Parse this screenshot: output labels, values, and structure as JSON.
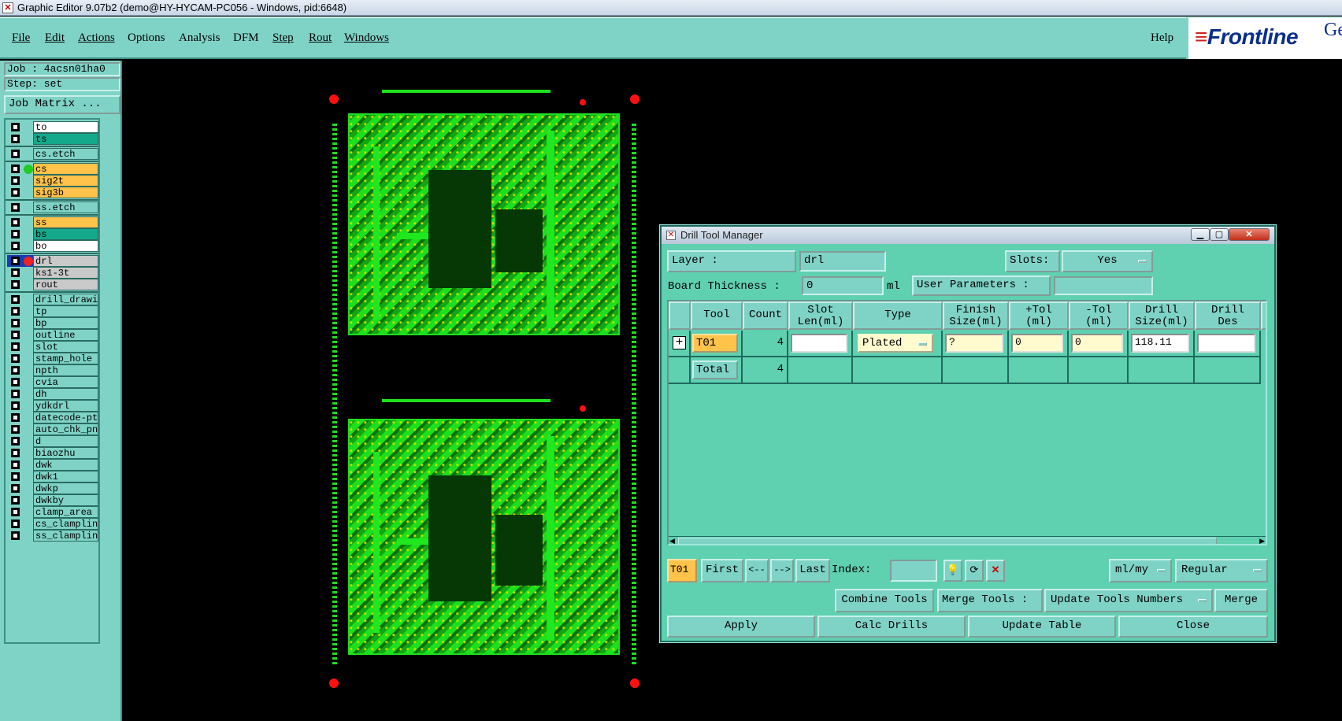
{
  "window": {
    "title": "Graphic Editor 9.07b2 (demo@HY-HYCAM-PC056 - Windows, pid:6648)"
  },
  "menu": {
    "items": [
      "File",
      "Edit",
      "Actions",
      "Options",
      "Analysis",
      "DFM",
      "Step",
      "Rout",
      "Windows"
    ],
    "help": "Help"
  },
  "logo": {
    "text": "Frontline",
    "suffix": "Ge"
  },
  "job_info": {
    "job": "Job : 4acsn01ha0",
    "step": "Step: set",
    "job_matrix": "Job Matrix ..."
  },
  "layers": [
    {
      "name": "to",
      "bg": "#ffffff"
    },
    {
      "name": "ts",
      "bg": "#14a98a"
    },
    {
      "name": "cs.etch",
      "bg": "#7fd3c6"
    },
    {
      "name": "cs",
      "bg": "#ffc24a",
      "indicator": "green"
    },
    {
      "name": "sig2t",
      "bg": "#ffc24a"
    },
    {
      "name": "sig3b",
      "bg": "#ffc24a"
    },
    {
      "name": "ss.etch",
      "bg": "#7fd3c6"
    },
    {
      "name": "ss",
      "bg": "#ffc24a"
    },
    {
      "name": "bs",
      "bg": "#14a98a"
    },
    {
      "name": "bo",
      "bg": "#ffffff"
    },
    {
      "name": "drl",
      "bg": "#c9c9c9",
      "indicator": "red",
      "selected": true
    },
    {
      "name": "ks1-3t",
      "bg": "#c9c9c9"
    },
    {
      "name": "rout",
      "bg": "#c9c9c9"
    },
    {
      "name": "drill_drawing",
      "bg": "#7fd3c6"
    },
    {
      "name": "tp",
      "bg": "#7fd3c6"
    },
    {
      "name": "bp",
      "bg": "#7fd3c6"
    },
    {
      "name": "outline",
      "bg": "#7fd3c6"
    },
    {
      "name": "slot",
      "bg": "#7fd3c6"
    },
    {
      "name": "stamp_hole",
      "bg": "#7fd3c6"
    },
    {
      "name": "npth",
      "bg": "#7fd3c6"
    },
    {
      "name": "cvia",
      "bg": "#7fd3c6"
    },
    {
      "name": "dh",
      "bg": "#7fd3c6"
    },
    {
      "name": "ydkdrl",
      "bg": "#7fd3c6"
    },
    {
      "name": "datecode-pth",
      "bg": "#7fd3c6"
    },
    {
      "name": "auto_chk_pn",
      "bg": "#7fd3c6"
    },
    {
      "name": "d",
      "bg": "#7fd3c6"
    },
    {
      "name": "biaozhu",
      "bg": "#7fd3c6"
    },
    {
      "name": "dwk",
      "bg": "#7fd3c6"
    },
    {
      "name": "dwk1",
      "bg": "#7fd3c6"
    },
    {
      "name": "dwkp",
      "bg": "#7fd3c6"
    },
    {
      "name": "dwkby",
      "bg": "#7fd3c6"
    },
    {
      "name": "clamp_area",
      "bg": "#7fd3c6"
    },
    {
      "name": "cs_clampline",
      "bg": "#7fd3c6"
    },
    {
      "name": "ss_clampline",
      "bg": "#7fd3c6"
    }
  ],
  "dialog": {
    "title": "Drill Tool Manager",
    "layer_label": "Layer          :",
    "layer_value": "drl",
    "slots_label": "Slots:",
    "slots_value": "Yes",
    "board_thickness_label": "Board Thickness :",
    "board_thickness_value": "0",
    "board_thickness_unit": "ml",
    "user_params_label": "User Parameters :",
    "user_params_value": "",
    "columns": {
      "tool": "Tool",
      "count": "Count",
      "slot_len_1": "Slot",
      "slot_len_2": "Len(ml)",
      "type": "Type",
      "finish_1": "Finish",
      "finish_2": "Size(ml)",
      "ptol_1": "+Tol",
      "ptol_2": "(ml)",
      "ntol_1": "-Tol",
      "ntol_2": "(ml)",
      "drill_1": "Drill",
      "drill_2": "Size(ml)",
      "des_1": "Drill",
      "des_2": "Des"
    },
    "rows": [
      {
        "tool": "T01",
        "count": "4",
        "slot_len": "",
        "type": "Plated",
        "finish": "?",
        "ptol": "0",
        "ntol": "0",
        "drill_size": "118.11",
        "drill_des": ""
      }
    ],
    "total": {
      "label": "Total",
      "count": "4"
    },
    "nav": {
      "current": "T01",
      "first": "First",
      "prev": "<--",
      "next": "-->",
      "last": "Last",
      "index_label": "Index:",
      "index_value": "",
      "units": "ml/my",
      "mode": "Regular"
    },
    "actions": {
      "combine": "Combine Tools",
      "merge_label": "Merge Tools :",
      "update_numbers": "Update Tools Numbers",
      "merge": "Merge"
    },
    "bottom": {
      "apply": "Apply",
      "calc": "Calc Drills",
      "update_table": "Update Table",
      "close": "Close"
    }
  }
}
